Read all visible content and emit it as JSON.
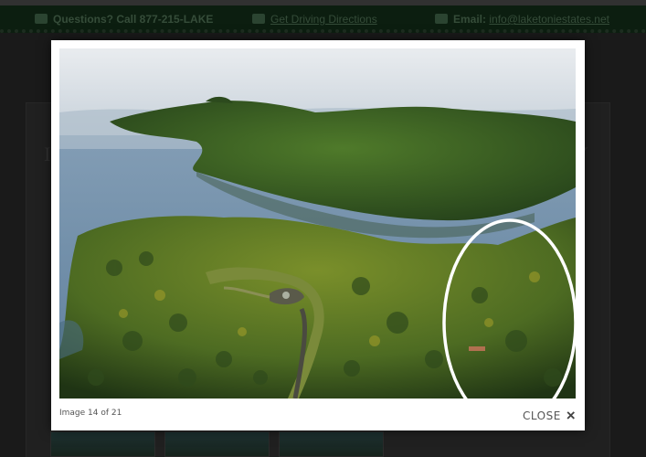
{
  "topbar": {
    "phone_text": "Questions? Call 877-215-LAKE",
    "directions_link": "Get Driving Directions",
    "email_label": "Email:",
    "email_link": "info@laketoniestates.net"
  },
  "lightbox": {
    "caption": "Image 14 of 21",
    "close_label": "CLOSE",
    "close_icon": "×"
  },
  "icons": {
    "phone": "phone-icon",
    "map": "map-icon",
    "email": "email-icon",
    "close": "close-icon"
  },
  "colors": {
    "topbar_bg": "#0f2413",
    "modal_bg": "#ffffff",
    "highlight_circle": "#ffffff"
  }
}
